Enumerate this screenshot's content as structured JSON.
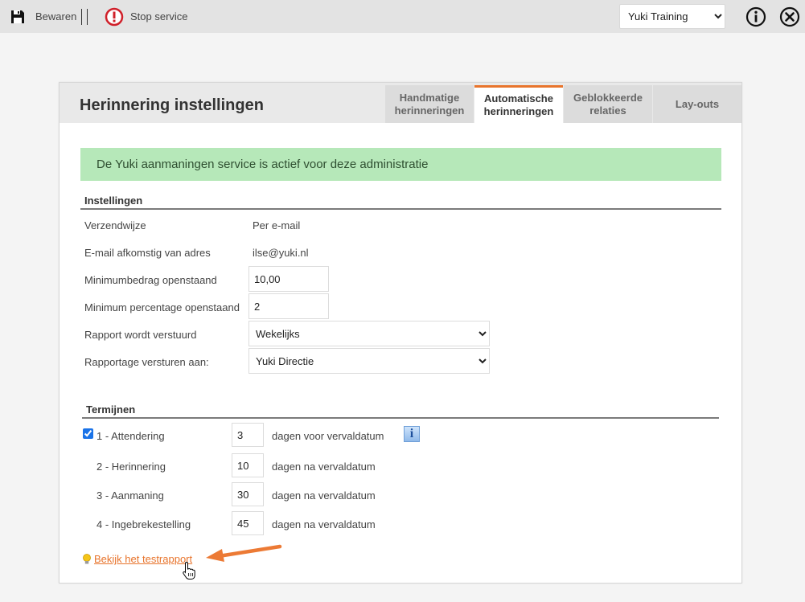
{
  "toolbar": {
    "save_label": "Bewaren",
    "stop_label": "Stop service",
    "admin_selected": "Yuki Training",
    "icons": {
      "save": "save-icon",
      "stop": "stop-icon",
      "info": "info-icon",
      "close": "close-icon"
    }
  },
  "panel": {
    "title": "Herinnering instellingen",
    "tabs": [
      {
        "line1": "Handmatige",
        "line2": "herinneringen"
      },
      {
        "line1": "Automatische",
        "line2": "herinneringen"
      },
      {
        "line1": "Geblokkeerde",
        "line2": "relaties"
      },
      {
        "line1": "Lay-outs",
        "line2": ""
      }
    ],
    "active_tab_color": "#e8742c",
    "banner": "De Yuki aanmaningen service is actief voor deze administratie",
    "banner_color": "#b6e8b9"
  },
  "settings": {
    "heading": "Instellingen",
    "rows": {
      "verzendwijze": {
        "label": "Verzendwijze",
        "value": "Per e-mail"
      },
      "email": {
        "label": "E-mail afkomstig van adres",
        "value": "ilse@yuki.nl"
      },
      "min_bedrag": {
        "label": "Minimumbedrag openstaand",
        "value": "10,00"
      },
      "min_perc": {
        "label": "Minimum percentage openstaand",
        "value": "2"
      },
      "rapport": {
        "label": "Rapport wordt verstuurd",
        "value": "Wekelijks"
      },
      "rapportage": {
        "label": "Rapportage versturen aan:",
        "value": "Yuki Directie"
      }
    }
  },
  "terms": {
    "heading": "Termijnen",
    "items": [
      {
        "label": "1 - Attendering",
        "days": "3",
        "desc": "dagen voor vervaldatum",
        "checked": true
      },
      {
        "label": "2 - Herinnering",
        "days": "10",
        "desc": "dagen na vervaldatum"
      },
      {
        "label": "3 - Aanmaning",
        "days": "30",
        "desc": "dagen na vervaldatum"
      },
      {
        "label": "4 - Ingebrekestelling",
        "days": "45",
        "desc": "dagen na vervaldatum"
      }
    ],
    "info_glyph": "i"
  },
  "test_link": "Bekijk het testrapport",
  "annotation_arrow_color": "#ec7a35"
}
